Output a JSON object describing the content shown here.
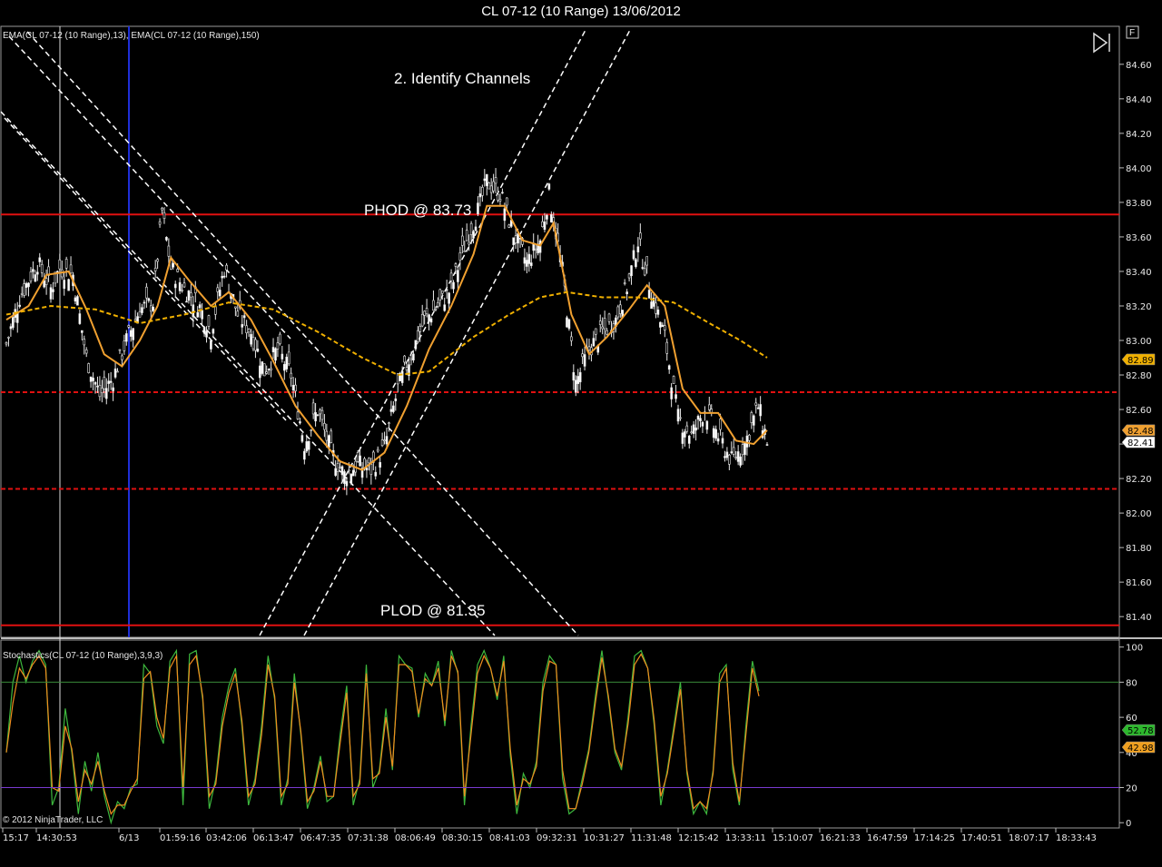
{
  "window": {
    "title": "CL 07-12 (10 Range)  13/06/2012",
    "panel_button": "F"
  },
  "chart_data": [
    {
      "type": "candlestick",
      "panel": "price",
      "indicator_label": "EMA(CL 07-12 (10 Range),13), EMA(CL 07-12 (10 Range),150)",
      "y_ticks": [
        "84.60",
        "84.40",
        "84.20",
        "84.00",
        "83.80",
        "83.60",
        "83.40",
        "83.20",
        "83.00",
        "82.80",
        "82.60",
        "82.40",
        "82.20",
        "82.00",
        "81.80",
        "81.60",
        "81.40"
      ],
      "ylim": [
        81.28,
        84.82
      ],
      "x_ticks": [
        "15:17",
        "14:30:53",
        "6/13",
        "01:59:16",
        "03:42:06",
        "06:13:47",
        "06:47:35",
        "07:31:38",
        "08:06:49",
        "08:30:15",
        "08:41:03",
        "09:32:31",
        "10:31:27",
        "11:31:48",
        "12:15:42",
        "13:33:11",
        "15:10:07",
        "16:21:33",
        "16:47:59",
        "17:14:25",
        "17:40:51",
        "18:07:17",
        "18:33:43"
      ],
      "close_path": [
        [
          0,
          82.98
        ],
        [
          6,
          83.25
        ],
        [
          14,
          83.45
        ],
        [
          20,
          83.3
        ],
        [
          24,
          83.42
        ],
        [
          30,
          83.38
        ],
        [
          36,
          82.9
        ],
        [
          42,
          82.68
        ],
        [
          48,
          82.78
        ],
        [
          54,
          83.0
        ],
        [
          60,
          83.18
        ],
        [
          66,
          83.22
        ],
        [
          70,
          83.75
        ],
        [
          74,
          83.42
        ],
        [
          80,
          83.3
        ],
        [
          86,
          83.22
        ],
        [
          92,
          83.05
        ],
        [
          98,
          83.42
        ],
        [
          104,
          83.15
        ],
        [
          110,
          83.05
        ],
        [
          116,
          82.82
        ],
        [
          122,
          82.95
        ],
        [
          128,
          82.8
        ],
        [
          134,
          82.4
        ],
        [
          140,
          82.6
        ],
        [
          146,
          82.35
        ],
        [
          152,
          82.22
        ],
        [
          158,
          82.28
        ],
        [
          164,
          82.25
        ],
        [
          170,
          82.38
        ],
        [
          176,
          82.72
        ],
        [
          182,
          82.92
        ],
        [
          188,
          83.12
        ],
        [
          194,
          83.2
        ],
        [
          200,
          83.3
        ],
        [
          206,
          83.55
        ],
        [
          212,
          83.75
        ],
        [
          216,
          83.92
        ],
        [
          222,
          83.85
        ],
        [
          228,
          83.62
        ],
        [
          234,
          83.45
        ],
        [
          240,
          83.58
        ],
        [
          244,
          83.85
        ],
        [
          250,
          83.4
        ],
        [
          256,
          82.75
        ],
        [
          262,
          82.95
        ],
        [
          268,
          83.05
        ],
        [
          274,
          83.12
        ],
        [
          280,
          83.35
        ],
        [
          284,
          83.58
        ],
        [
          290,
          83.28
        ],
        [
          296,
          83.02
        ],
        [
          302,
          82.55
        ],
        [
          308,
          82.45
        ],
        [
          314,
          82.6
        ],
        [
          320,
          82.45
        ],
        [
          326,
          82.3
        ],
        [
          332,
          82.4
        ],
        [
          338,
          82.62
        ],
        [
          342,
          82.42
        ]
      ],
      "series": [
        {
          "name": "EMA(CL 07-12 (10 Range),13)",
          "color": "#f0a030",
          "points": [
            [
              0,
              83.12
            ],
            [
              10,
              83.2
            ],
            [
              18,
              83.38
            ],
            [
              28,
              83.4
            ],
            [
              36,
              83.18
            ],
            [
              44,
              82.92
            ],
            [
              52,
              82.85
            ],
            [
              60,
              83.0
            ],
            [
              68,
              83.2
            ],
            [
              74,
              83.48
            ],
            [
              82,
              83.35
            ],
            [
              92,
              83.2
            ],
            [
              100,
              83.28
            ],
            [
              110,
              83.12
            ],
            [
              120,
              82.88
            ],
            [
              130,
              82.62
            ],
            [
              140,
              82.45
            ],
            [
              150,
              82.3
            ],
            [
              160,
              82.25
            ],
            [
              170,
              82.35
            ],
            [
              180,
              82.62
            ],
            [
              190,
              82.95
            ],
            [
              200,
              83.2
            ],
            [
              210,
              83.5
            ],
            [
              216,
              83.78
            ],
            [
              224,
              83.78
            ],
            [
              232,
              83.58
            ],
            [
              240,
              83.55
            ],
            [
              246,
              83.68
            ],
            [
              254,
              83.15
            ],
            [
              262,
              82.92
            ],
            [
              270,
              83.02
            ],
            [
              280,
              83.18
            ],
            [
              288,
              83.32
            ],
            [
              296,
              83.2
            ],
            [
              304,
              82.72
            ],
            [
              312,
              82.58
            ],
            [
              320,
              82.58
            ],
            [
              328,
              82.42
            ],
            [
              336,
              82.4
            ],
            [
              342,
              82.48
            ]
          ]
        },
        {
          "name": "EMA(CL 07-12 (10 Range),150)",
          "color": "#f0b000",
          "points": [
            [
              0,
              83.15
            ],
            [
              20,
              83.2
            ],
            [
              40,
              83.18
            ],
            [
              60,
              83.1
            ],
            [
              80,
              83.15
            ],
            [
              100,
              83.22
            ],
            [
              120,
              83.18
            ],
            [
              140,
              83.05
            ],
            [
              160,
              82.9
            ],
            [
              176,
              82.8
            ],
            [
              190,
              82.82
            ],
            [
              200,
              82.92
            ],
            [
              210,
              83.02
            ],
            [
              226,
              83.15
            ],
            [
              240,
              83.25
            ],
            [
              252,
              83.28
            ],
            [
              268,
              83.25
            ],
            [
              284,
              83.25
            ],
            [
              300,
              83.22
            ],
            [
              316,
              83.1
            ],
            [
              330,
              83.0
            ],
            [
              342,
              82.9
            ]
          ]
        }
      ],
      "last_values": [
        {
          "value": "82.89",
          "color": "#f0b000",
          "price": 82.89
        },
        {
          "value": "82.48",
          "color": "#f0a030",
          "price": 82.48
        },
        {
          "value": "82.41",
          "color": "#ffffff",
          "price": 82.41
        }
      ],
      "horizontal_lines": [
        {
          "price": 83.73,
          "style": "solid",
          "color": "#e01010"
        },
        {
          "price": 82.7,
          "style": "dashed",
          "color": "#e01010"
        },
        {
          "price": 82.14,
          "style": "dashed",
          "color": "#e01010"
        },
        {
          "price": 81.35,
          "style": "solid",
          "color": "#e01010"
        }
      ],
      "annotations": [
        "2. Identify Channels",
        "PHOD @ 83.73",
        "PLOD @ 81.35"
      ]
    },
    {
      "type": "line",
      "panel": "stochastics",
      "indicator_label": "Stochastics(CL 07-12 (10 Range),3,9,3)",
      "y_ticks": [
        "100",
        "80",
        "60",
        "40",
        "20",
        "0"
      ],
      "ylim": [
        -3,
        104
      ],
      "levels": [
        {
          "value": 80,
          "color": "#3a8a3a"
        },
        {
          "value": 20,
          "color": "#7a3ad0"
        }
      ],
      "series": [
        {
          "name": "K",
          "color": "#3db83d",
          "values": [
            40,
            80,
            95,
            80,
            92,
            98,
            90,
            10,
            20,
            65,
            40,
            5,
            35,
            18,
            40,
            15,
            0,
            12,
            8,
            20,
            22,
            90,
            85,
            55,
            45,
            92,
            98,
            10,
            96,
            98,
            70,
            8,
            25,
            60,
            78,
            88,
            55,
            10,
            25,
            55,
            95,
            70,
            10,
            25,
            85,
            50,
            8,
            20,
            38,
            12,
            15,
            50,
            78,
            10,
            25,
            90,
            20,
            30,
            65,
            30,
            95,
            90,
            88,
            60,
            85,
            78,
            92,
            55,
            98,
            85,
            10,
            55,
            90,
            98,
            88,
            70,
            95,
            38,
            5,
            28,
            20,
            35,
            80,
            95,
            90,
            25,
            5,
            8,
            25,
            42,
            72,
            98,
            70,
            40,
            30,
            60,
            95,
            98,
            88,
            55,
            10,
            30,
            55,
            80,
            28,
            5,
            12,
            5,
            30,
            85,
            90,
            30,
            10,
            55,
            92,
            75
          ]
        },
        {
          "name": "D",
          "color": "#f08c1e",
          "values": [
            40,
            68,
            88,
            82,
            90,
            95,
            88,
            20,
            18,
            55,
            42,
            12,
            30,
            22,
            35,
            18,
            5,
            10,
            10,
            18,
            25,
            82,
            86,
            60,
            48,
            88,
            95,
            20,
            90,
            95,
            72,
            15,
            22,
            55,
            74,
            85,
            58,
            15,
            22,
            50,
            90,
            72,
            15,
            22,
            80,
            52,
            12,
            18,
            35,
            15,
            15,
            45,
            74,
            15,
            22,
            85,
            25,
            28,
            60,
            32,
            90,
            90,
            86,
            62,
            82,
            78,
            88,
            58,
            95,
            86,
            15,
            50,
            85,
            95,
            88,
            72,
            92,
            42,
            10,
            25,
            22,
            32,
            75,
            92,
            90,
            30,
            8,
            8,
            22,
            40,
            68,
            94,
            72,
            42,
            32,
            56,
            90,
            96,
            88,
            58,
            15,
            28,
            52,
            76,
            30,
            8,
            12,
            8,
            28,
            80,
            88,
            34,
            12,
            50,
            88,
            72
          ]
        }
      ],
      "last_values": [
        {
          "value": "52.78",
          "color": "#2db82d",
          "level": 52.78
        },
        {
          "value": "42.98",
          "color": "#f0a020",
          "level": 42.98
        }
      ]
    }
  ],
  "footer": {
    "copyright": "© 2012 NinjaTrader, LLC"
  }
}
